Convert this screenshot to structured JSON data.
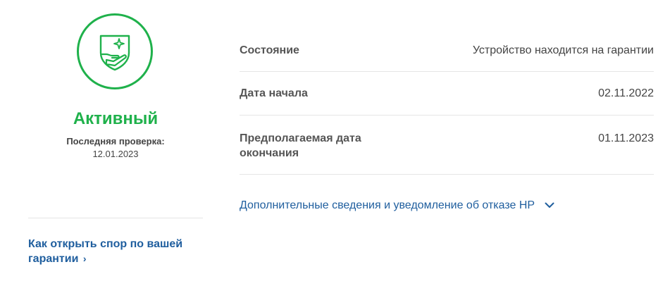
{
  "warranty_status": {
    "icon": "shield-hand-sparkle-icon",
    "status": "Активный",
    "last_check_label": "Последняя проверка:",
    "last_check_date": "12.01.2023",
    "status_color": "#1fb14b"
  },
  "dispute_link": {
    "label": "Как открыть спор по вашей гарантии",
    "chevron": "›"
  },
  "details": {
    "rows": [
      {
        "label": "Состояние",
        "value": "Устройство находится на гарантии"
      },
      {
        "label": "Дата начала",
        "value": "02.11.2022"
      },
      {
        "label": "Предполагаемая дата окончания",
        "value": "01.11.2023"
      }
    ]
  },
  "more_info": {
    "label": "Дополнительные сведения и уведомление об отказе HP",
    "icon": "chevron-down-icon"
  },
  "colors": {
    "link": "#1f5e9e",
    "accent": "#1fb14b"
  }
}
